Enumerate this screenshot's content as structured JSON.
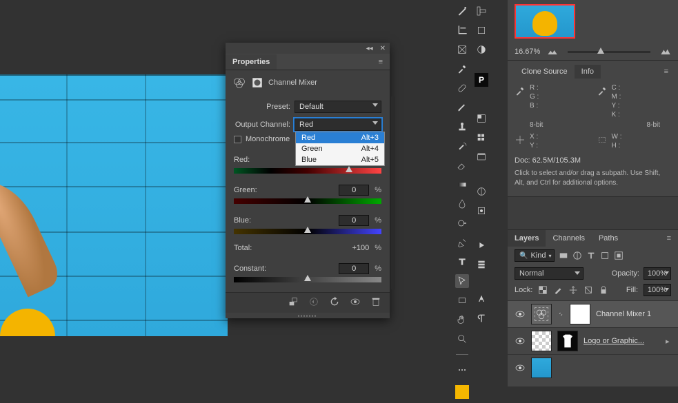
{
  "properties": {
    "panel_title": "Properties",
    "adjustment_name": "Channel Mixer",
    "preset_label": "Preset:",
    "preset_value": "Default",
    "output_channel_label": "Output Channel:",
    "output_channel_value": "Red",
    "output_options": [
      {
        "label": "Red",
        "shortcut": "Alt+3"
      },
      {
        "label": "Green",
        "shortcut": "Alt+4"
      },
      {
        "label": "Blue",
        "shortcut": "Alt+5"
      }
    ],
    "monochrome_label": "Monochrome",
    "sliders": {
      "red": {
        "label": "Red:",
        "value": ""
      },
      "green": {
        "label": "Green:",
        "value": "0"
      },
      "blue": {
        "label": "Blue:",
        "value": "0"
      },
      "constant": {
        "label": "Constant:",
        "value": "0"
      }
    },
    "total_label": "Total:",
    "total_value": "+100",
    "percent": "%"
  },
  "navigator": {
    "zoom": "16.67%"
  },
  "info": {
    "tabs": {
      "clone": "Clone Source",
      "info": "Info"
    },
    "rgb": {
      "r": "R :",
      "g": "G :",
      "b": "B :",
      "bit": "8-bit"
    },
    "cmyk": {
      "c": "C :",
      "m": "M :",
      "y": "Y :",
      "k": "K :",
      "bit": "8-bit"
    },
    "xy": {
      "x": "X :",
      "y": "Y :"
    },
    "wh": {
      "w": "W :",
      "h": "H :"
    },
    "doc": "Doc: 62.5M/105.3M",
    "hint": "Click to select and/or drag a subpath.  Use Shift, Alt, and Ctrl for additional options."
  },
  "layers": {
    "tabs": {
      "layers": "Layers",
      "channels": "Channels",
      "paths": "Paths"
    },
    "kind_label": "Kind",
    "blend": "Normal",
    "opacity_label": "Opacity:",
    "opacity_value": "100%",
    "lock_label": "Lock:",
    "fill_label": "Fill:",
    "fill_value": "100%",
    "layer1": "Channel Mixer 1",
    "layer2": "Logo or Graphic..."
  },
  "search_icon": "⌕"
}
